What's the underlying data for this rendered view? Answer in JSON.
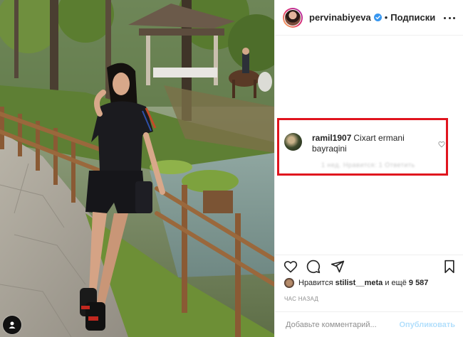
{
  "header": {
    "username": "pervinabiyeva",
    "separator": "•",
    "follow_label": "Подписки"
  },
  "comments": [
    {
      "username": "ramil1907",
      "text": "Cixart ermani bayraqini",
      "meta": "1 нед.   Нравится: 1   Ответить"
    }
  ],
  "highlight_color": "#e0141e",
  "likes": {
    "prefix": "Нравится ",
    "user": "stilist__meta",
    "middle": " и ещё ",
    "count": "9 587"
  },
  "time_label": "ЧАС НАЗАД",
  "add_comment": {
    "placeholder": "Добавьте комментарий...",
    "post_label": "Опубликовать"
  },
  "icons": [
    "heart-icon",
    "comment-icon",
    "share-icon",
    "bookmark-icon",
    "more-icon",
    "verified-icon"
  ]
}
